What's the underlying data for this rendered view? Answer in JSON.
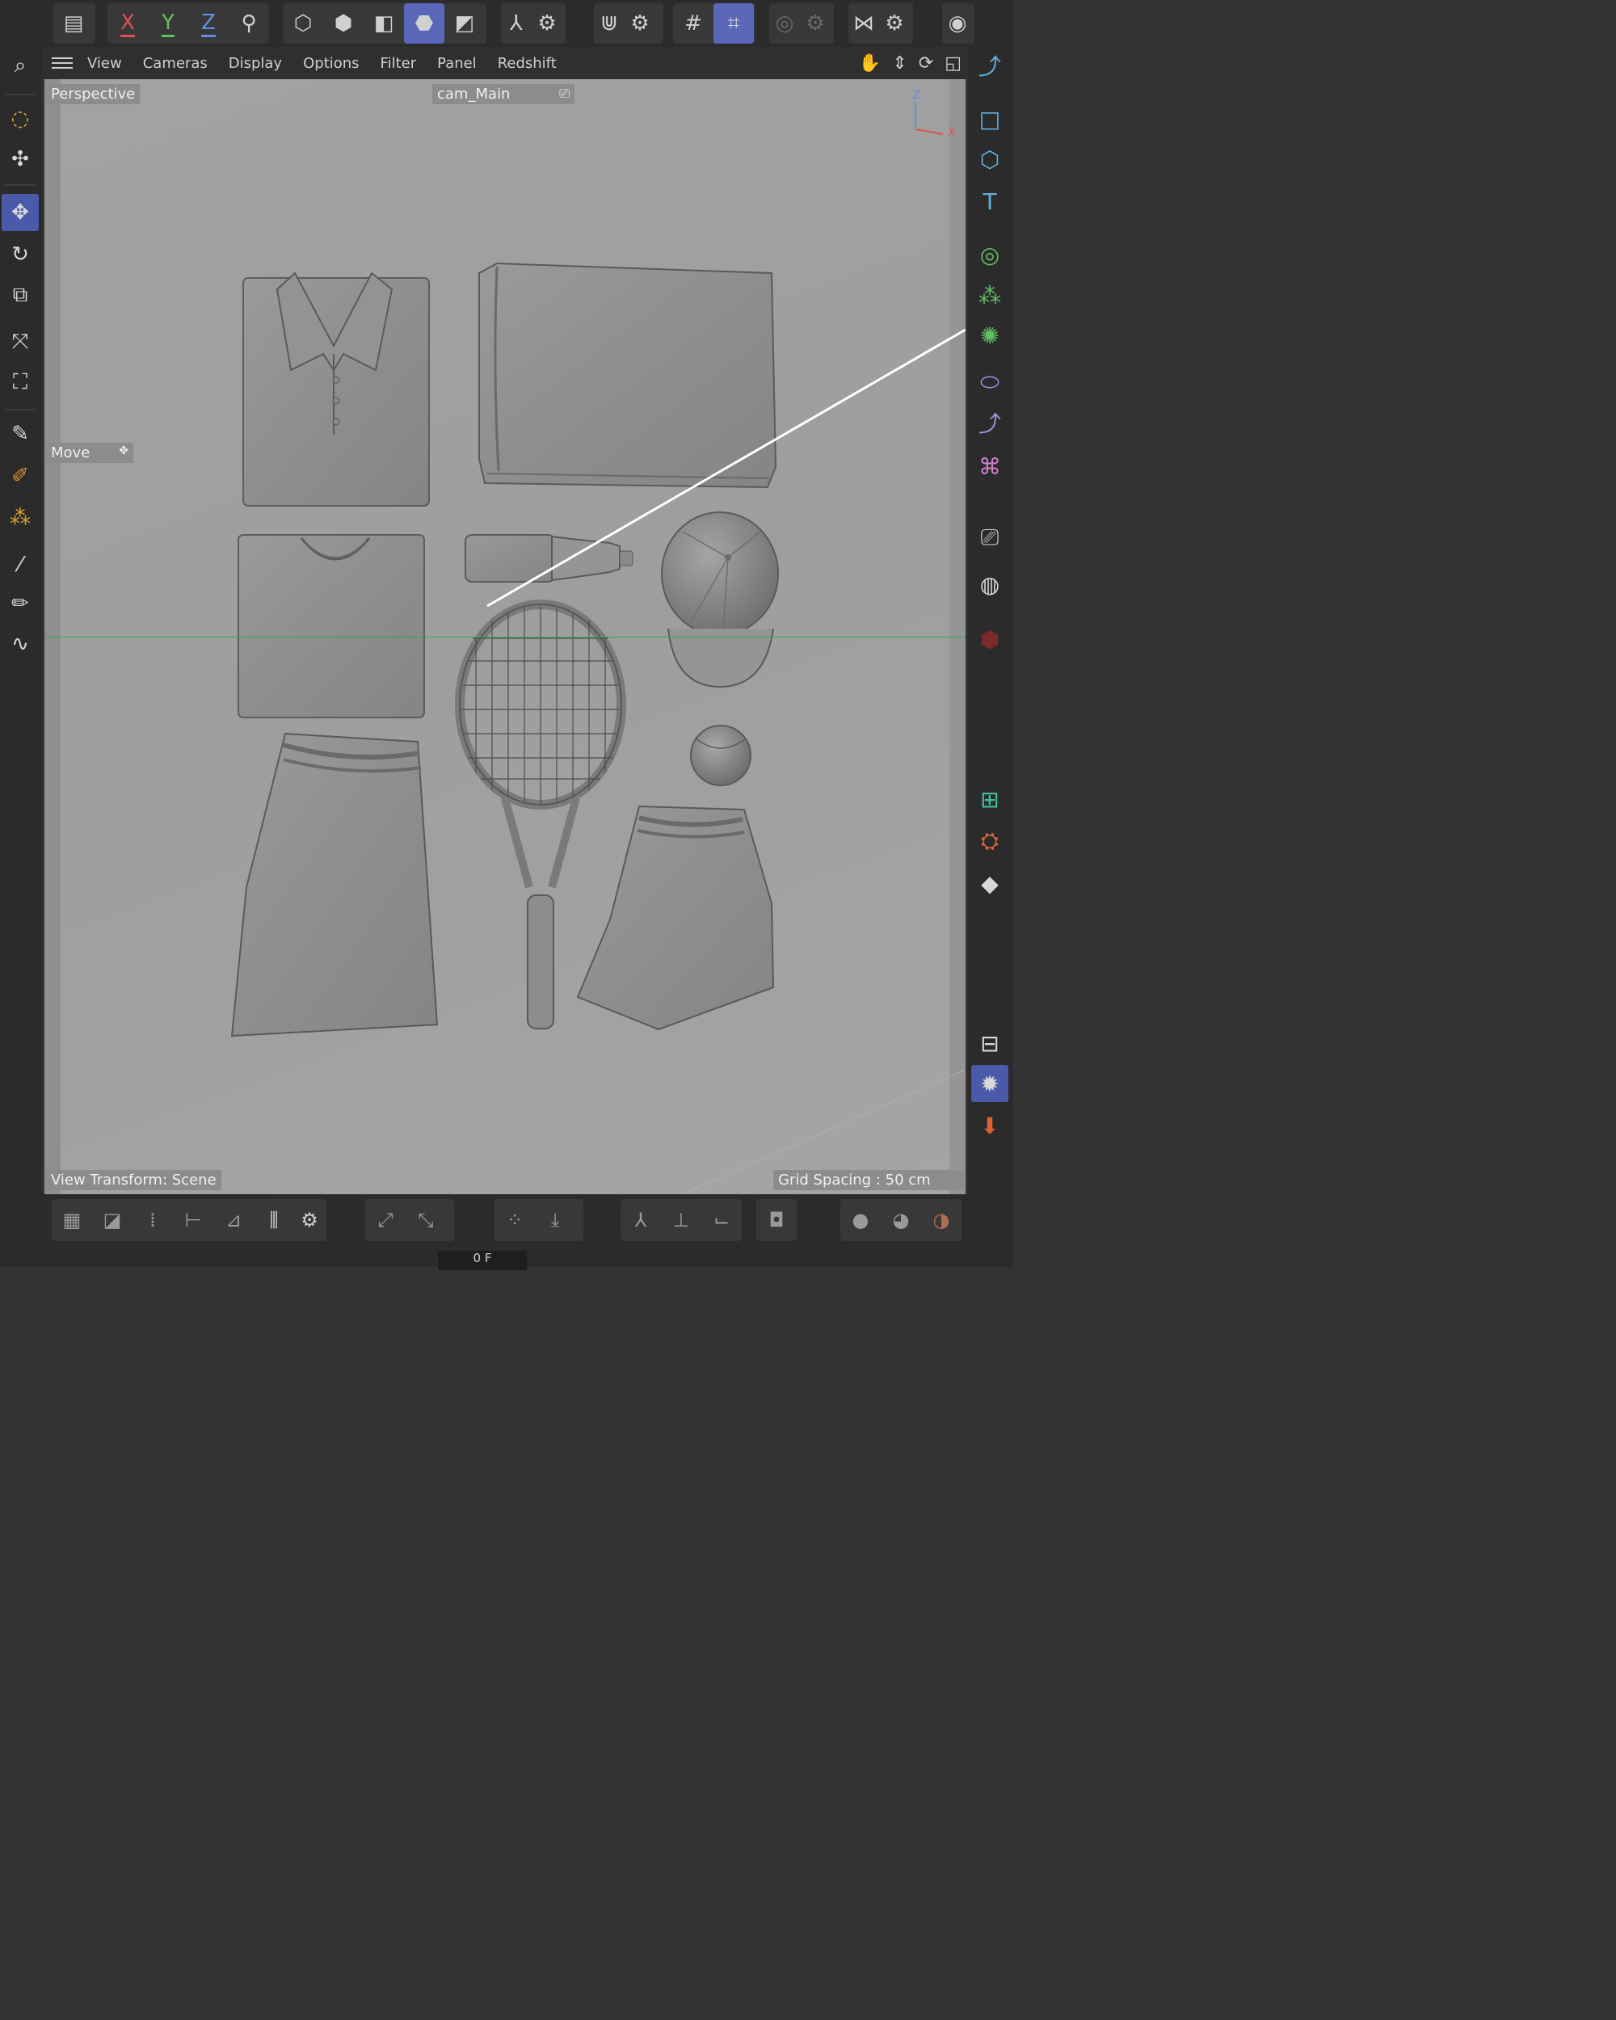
{
  "menu": {
    "items": [
      "View",
      "Cameras",
      "Display",
      "Options",
      "Filter",
      "Panel",
      "Redshift"
    ]
  },
  "toolbar": {
    "axis_x": "X",
    "axis_y": "Y",
    "axis_z": "Z"
  },
  "viewport": {
    "view_name": "Perspective",
    "camera_name": "cam_Main",
    "active_tool": "Move",
    "view_transform": "View Transform: Scene",
    "grid_spacing": "Grid Spacing : 50 cm",
    "axis_x": "X",
    "axis_z": "Z"
  },
  "timeline": {
    "current_value": "0 F"
  },
  "colors": {
    "accent": "#4a5aa8",
    "axis_x": "#e05050",
    "axis_y": "#60c060",
    "axis_z": "#6090e0",
    "grid_line": "#3aa34a"
  }
}
